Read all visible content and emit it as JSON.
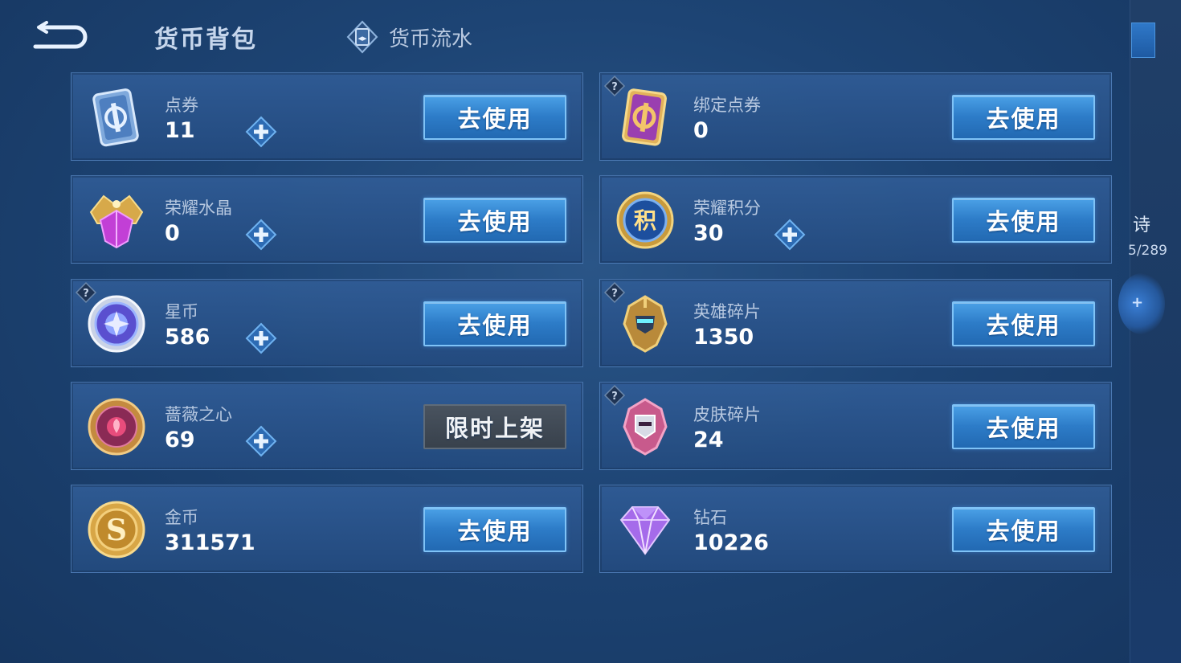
{
  "header": {
    "title": "货币背包",
    "flow_tab_label": "货币流水"
  },
  "right_panel": {
    "text1": "诗",
    "text2": "5/289"
  },
  "cards": [
    {
      "name": "点券",
      "value": "11",
      "icon": "coupon-card-icon",
      "has_plus": true,
      "has_help": false,
      "button": "去使用",
      "button_style": "blue"
    },
    {
      "name": "绑定点券",
      "value": "0",
      "icon": "bound-coupon-card-icon",
      "has_plus": false,
      "has_help": true,
      "button": "去使用",
      "button_style": "blue"
    },
    {
      "name": "荣耀水晶",
      "value": "0",
      "icon": "glory-crystal-icon",
      "has_plus": true,
      "has_help": false,
      "button": "去使用",
      "button_style": "blue"
    },
    {
      "name": "荣耀积分",
      "value": "30",
      "icon": "glory-points-icon",
      "has_plus": true,
      "has_help": false,
      "button": "去使用",
      "button_style": "blue"
    },
    {
      "name": "星币",
      "value": "586",
      "icon": "star-coin-icon",
      "has_plus": true,
      "has_help": true,
      "button": "去使用",
      "button_style": "blue"
    },
    {
      "name": "英雄碎片",
      "value": "1350",
      "icon": "hero-fragment-icon",
      "has_plus": false,
      "has_help": true,
      "button": "去使用",
      "button_style": "blue"
    },
    {
      "name": "蔷薇之心",
      "value": "69",
      "icon": "rose-heart-icon",
      "has_plus": true,
      "has_help": false,
      "button": "限时上架",
      "button_style": "gray"
    },
    {
      "name": "皮肤碎片",
      "value": "24",
      "icon": "skin-fragment-icon",
      "has_plus": false,
      "has_help": true,
      "button": "去使用",
      "button_style": "blue"
    },
    {
      "name": "金币",
      "value": "311571",
      "icon": "gold-coin-icon",
      "has_plus": false,
      "has_help": false,
      "button": "去使用",
      "button_style": "blue"
    },
    {
      "name": "钻石",
      "value": "10226",
      "icon": "diamond-icon",
      "has_plus": false,
      "has_help": false,
      "button": "去使用",
      "button_style": "blue"
    }
  ]
}
